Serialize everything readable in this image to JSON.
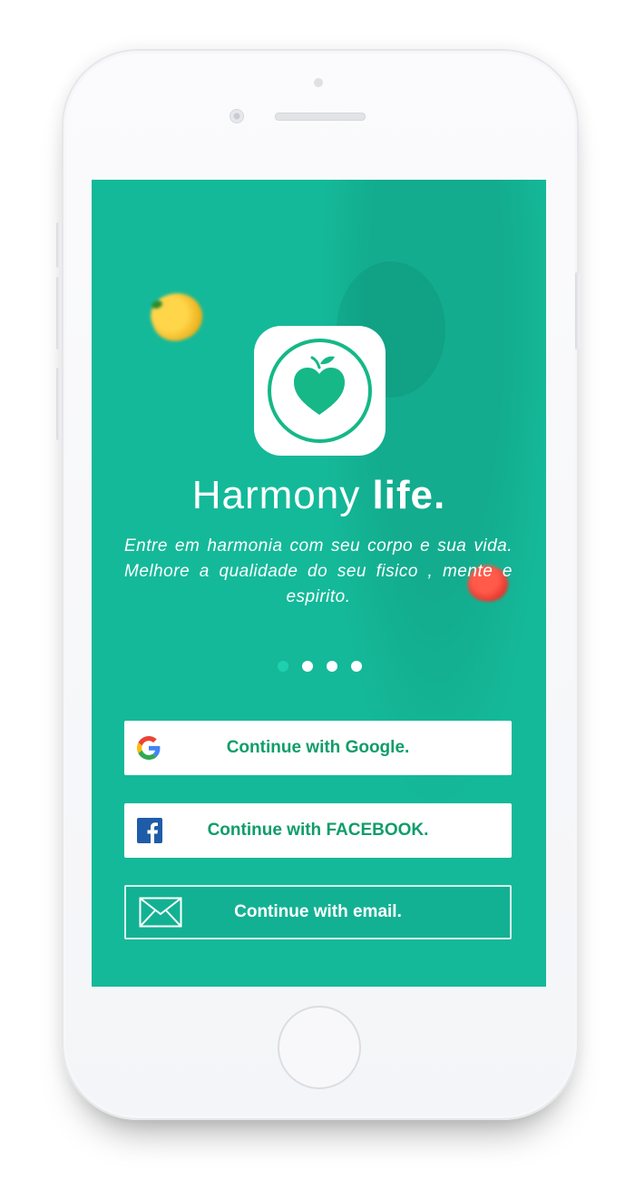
{
  "app": {
    "title_light": "Harmony ",
    "title_bold": "life.",
    "subtitle": "Entre em harmonia com seu corpo e sua vida. Melhore a qualidade do seu fisico , mente e espirito."
  },
  "carousel": {
    "pages": 4,
    "active_index": 0
  },
  "buttons": {
    "google": {
      "label": "Continue with Google.",
      "icon": "google-icon"
    },
    "facebook": {
      "label": "Continue with FACEBOOK.",
      "icon": "facebook-icon"
    },
    "email": {
      "label": "Continue with email.",
      "icon": "envelope-icon"
    }
  },
  "colors": {
    "screen_bg": "#14b999",
    "brand_green": "#15b886",
    "button_text": "#0f9d6a",
    "facebook_blue": "#1f5ca8"
  }
}
